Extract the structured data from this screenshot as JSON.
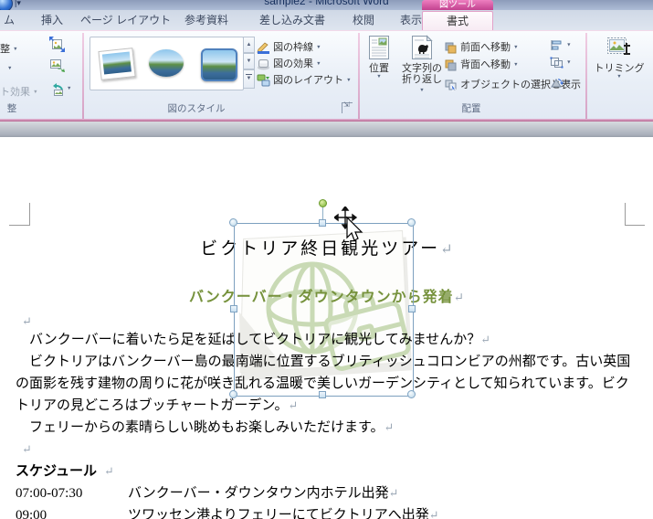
{
  "window": {
    "title": "sample2 - Microsoft Word"
  },
  "icons": {
    "dropdown": "▼",
    "up_arrow": "▲",
    "down_arrow": "▼",
    "more_arrow": "▼"
  },
  "colors": {
    "subtitle_green": "#76923C",
    "contextual_pink": "#C2428F",
    "selection_blue": "#7DA0BF"
  },
  "ribbon": {
    "contextual_header": "図ツール",
    "tabs": [
      "ム",
      "挿入",
      "ページ レイアウト",
      "参考資料",
      "差し込み文書",
      "校閲",
      "表示"
    ],
    "active_tab": "書式",
    "adjust": {
      "corrections": "整",
      "artistic_effects": "ト効果",
      "group_label": "整"
    },
    "picture_styles": {
      "border": "図の枠線",
      "effects": "図の効果",
      "layout": "図のレイアウト",
      "group_label": "図のスタイル"
    },
    "arrange": {
      "position": "位置",
      "wrap_line1": "文字列の",
      "wrap_line2": "折り返し",
      "bring_forward": "前面へ移動",
      "send_backward": "背面へ移動",
      "selection_pane": "オブジェクトの選択と表示",
      "group_label": "配置"
    },
    "size": {
      "crop": "トリミング"
    }
  },
  "document": {
    "pilcrow": "↵",
    "title": "ビクトリア終日観光ツアー",
    "subtitle": "バンクーバー・ダウンタウンから発着",
    "paragraphs": [
      "　バンクーバーに着いたら足を延ばしてビクトリアに観光してみませんか？",
      "　ビクトリアはバンクーバー島の最南端に位置するブリティッシュコロンビアの州都です。古い英国の面影を残す建物の周りに花が咲き乱れる温暖で美しいガーデンシティとして知られています。ビクトリアの見どころはブッチャートガーデン。",
      "　フェリーからの素晴らしい眺めもお楽しみいただけます。"
    ],
    "schedule_heading": "スケジュール",
    "schedule": [
      {
        "time": "07:00-07:30",
        "desc": "バンクーバー・ダウンタウン内ホテル出発"
      },
      {
        "time": "09:00",
        "desc": "ツワッセン港よりフェリーにてビクトリアへ出発"
      }
    ]
  }
}
